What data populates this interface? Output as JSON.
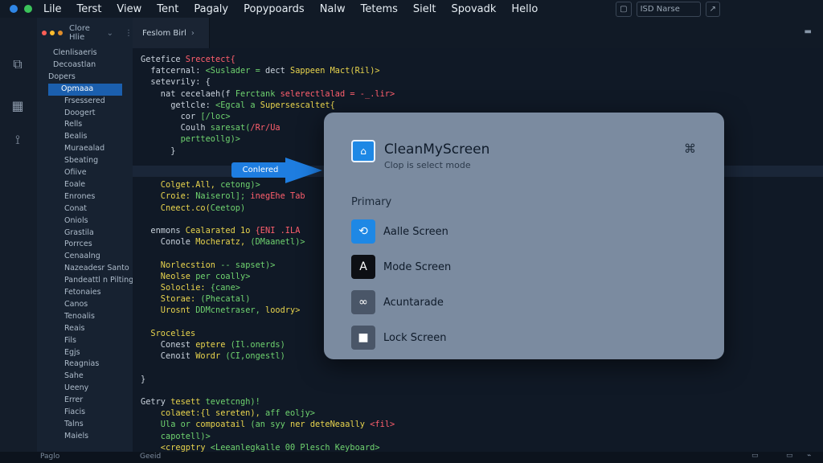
{
  "menubar": {
    "items": [
      "Lile",
      "Terst",
      "View",
      "Tent",
      "Pagaly",
      "Popypoards",
      "Nalw",
      "Tetems",
      "Sielt",
      "Spovadk",
      "Hello"
    ],
    "right_label": "ISD Narse"
  },
  "explorer": {
    "header": "Clore Hlie",
    "items": [
      "Clenlisaeris",
      "Decoastlan",
      "Dopers",
      "Opmaaa",
      "Frsessered",
      "Doogert",
      "Rells",
      "Bealis",
      "Muraealad",
      "Sbeating",
      "Ofiive",
      "Eoale",
      "Enrones",
      "Conat",
      "Oniols",
      "Grastila",
      "Porrces",
      "Cenaalng",
      "Nazeadesr Santo",
      "Pandeattl n Pilting",
      "Fetonaies",
      "Canos",
      "Tenoalis",
      "Reais",
      "Fils",
      "Egjs",
      "Reagnias",
      "Sahe",
      "Ueeny",
      "Errer",
      "Fiacis",
      "Talns",
      "Maiels"
    ],
    "selected": "Opmaaa"
  },
  "tab": {
    "label": "Feslom Birl"
  },
  "code_lines": [
    [
      {
        "t": "Getefice ",
        "c": "k4"
      },
      {
        "t": "Srecetect{",
        "c": "k2"
      }
    ],
    [
      {
        "t": "  fatcernal: ",
        "c": "k4"
      },
      {
        "t": "<Suslader = ",
        "c": "k3"
      },
      {
        "t": "dect ",
        "c": "k4"
      },
      {
        "t": "Sappeen Mact(Ril)>",
        "c": "k1"
      }
    ],
    [
      {
        "t": "  setevrily: {",
        "c": "k4"
      }
    ],
    [
      {
        "t": "    nat ",
        "c": "k4"
      },
      {
        "t": "cecelaeh(f ",
        "c": "k4"
      },
      {
        "t": "Ferctank ",
        "c": "k3"
      },
      {
        "t": "selerectlalad = -_.lir>",
        "c": "k2"
      }
    ],
    [
      {
        "t": "      getlcle: ",
        "c": "k4"
      },
      {
        "t": "<Egcal a ",
        "c": "k3"
      },
      {
        "t": "Supersescaltet{",
        "c": "k1"
      }
    ],
    [
      {
        "t": "        cor ",
        "c": "k4"
      },
      {
        "t": "[/loc>",
        "c": "k3"
      }
    ],
    [
      {
        "t": "        Coulh ",
        "c": "k4"
      },
      {
        "t": "saresat(",
        "c": "k3"
      },
      {
        "t": "/Rr/Ua",
        "c": "k2"
      }
    ],
    [
      {
        "t": "        pertteollg)>",
        "c": "k3"
      }
    ],
    [
      {
        "t": "      }",
        "c": "k4"
      }
    ],
    [
      {
        "t": "",
        "c": "k4"
      }
    ],
    [
      {
        "t": "",
        "c": "k4"
      }
    ],
    [
      {
        "t": "    Colget.All, ",
        "c": "k1"
      },
      {
        "t": "cetong)>",
        "c": "k3"
      }
    ],
    [
      {
        "t": "    Croie: ",
        "c": "k1"
      },
      {
        "t": "Naiserol]; ",
        "c": "k3"
      },
      {
        "t": "inegEhe Tab",
        "c": "k2"
      }
    ],
    [
      {
        "t": "    Cneect.co(",
        "c": "k1"
      },
      {
        "t": "Ceetop)",
        "c": "k3"
      }
    ],
    [
      {
        "t": "",
        "c": "k4"
      }
    ],
    [
      {
        "t": "  enmons ",
        "c": "k4"
      },
      {
        "t": "Cealarated 1o ",
        "c": "k1"
      },
      {
        "t": "{ENI .ILA",
        "c": "k2"
      }
    ],
    [
      {
        "t": "    Conole ",
        "c": "k4"
      },
      {
        "t": "Mocheratz, ",
        "c": "k1"
      },
      {
        "t": "(DMaanetl)>",
        "c": "k3"
      }
    ],
    [
      {
        "t": "",
        "c": "k4"
      }
    ],
    [
      {
        "t": "    Norlecstion ",
        "c": "k1"
      },
      {
        "t": "-- sapset)>",
        "c": "k3"
      }
    ],
    [
      {
        "t": "    Neolse ",
        "c": "k1"
      },
      {
        "t": "per coally>",
        "c": "k3"
      }
    ],
    [
      {
        "t": "    Soloclie: ",
        "c": "k1"
      },
      {
        "t": "{cane>",
        "c": "k3"
      }
    ],
    [
      {
        "t": "    Storae: ",
        "c": "k1"
      },
      {
        "t": "(Phecatal)",
        "c": "k3"
      }
    ],
    [
      {
        "t": "    Urosnt ",
        "c": "k1"
      },
      {
        "t": "DDMcnetraser, ",
        "c": "k3"
      },
      {
        "t": "loodry>",
        "c": "k1"
      }
    ],
    [
      {
        "t": "",
        "c": "k4"
      }
    ],
    [
      {
        "t": "  Srocelies",
        "c": "k1"
      }
    ],
    [
      {
        "t": "    Conest ",
        "c": "k4"
      },
      {
        "t": "eptere ",
        "c": "k1"
      },
      {
        "t": "(Il.onerds)",
        "c": "k3"
      }
    ],
    [
      {
        "t": "    Cenoit ",
        "c": "k4"
      },
      {
        "t": "Wordr ",
        "c": "k1"
      },
      {
        "t": "(CI,ongestl)",
        "c": "k3"
      }
    ],
    [
      {
        "t": "",
        "c": "k4"
      }
    ],
    [
      {
        "t": "}",
        "c": "k4"
      }
    ],
    [
      {
        "t": "",
        "c": "k4"
      }
    ],
    [
      {
        "t": "Getry ",
        "c": "k4"
      },
      {
        "t": "tesett ",
        "c": "k1"
      },
      {
        "t": "tevetcngh)!",
        "c": "k3"
      }
    ],
    [
      {
        "t": "    colaeet:{l sereten), ",
        "c": "k1"
      },
      {
        "t": "aff eoljy>",
        "c": "k3"
      }
    ],
    [
      {
        "t": "    Ula or ",
        "c": "k3"
      },
      {
        "t": "compoatail ",
        "c": "k1"
      },
      {
        "t": "(an syy ",
        "c": "k3"
      },
      {
        "t": "ner deteNeaally ",
        "c": "k1"
      },
      {
        "t": "<fil>",
        "c": "k2"
      }
    ],
    [
      {
        "t": "    capotell)>",
        "c": "k3"
      }
    ],
    [
      {
        "t": "    <cregptry ",
        "c": "k1"
      },
      {
        "t": "<Leeanlegkalle 00 Plesch Keyboard>",
        "c": "k3"
      }
    ]
  ],
  "callout": {
    "label": "Conlered"
  },
  "status": {
    "left": "Paglo",
    "middle": "Geeid"
  },
  "dialog": {
    "title": "CleanMyScreen",
    "subtitle": "Clop is select mode",
    "section": "Primary",
    "options": [
      {
        "label": "Aalle Screen",
        "icon": "refresh-screen-icon",
        "color": "#1e88e5"
      },
      {
        "label": "Mode Screen",
        "icon": "text-cursor-icon",
        "color": "#0d0f14"
      },
      {
        "label": "Acuntarade",
        "icon": "link-icon",
        "color": "#4a5668"
      },
      {
        "label": "Lock Screen",
        "icon": "lock-icon",
        "color": "#4a5668"
      }
    ]
  }
}
